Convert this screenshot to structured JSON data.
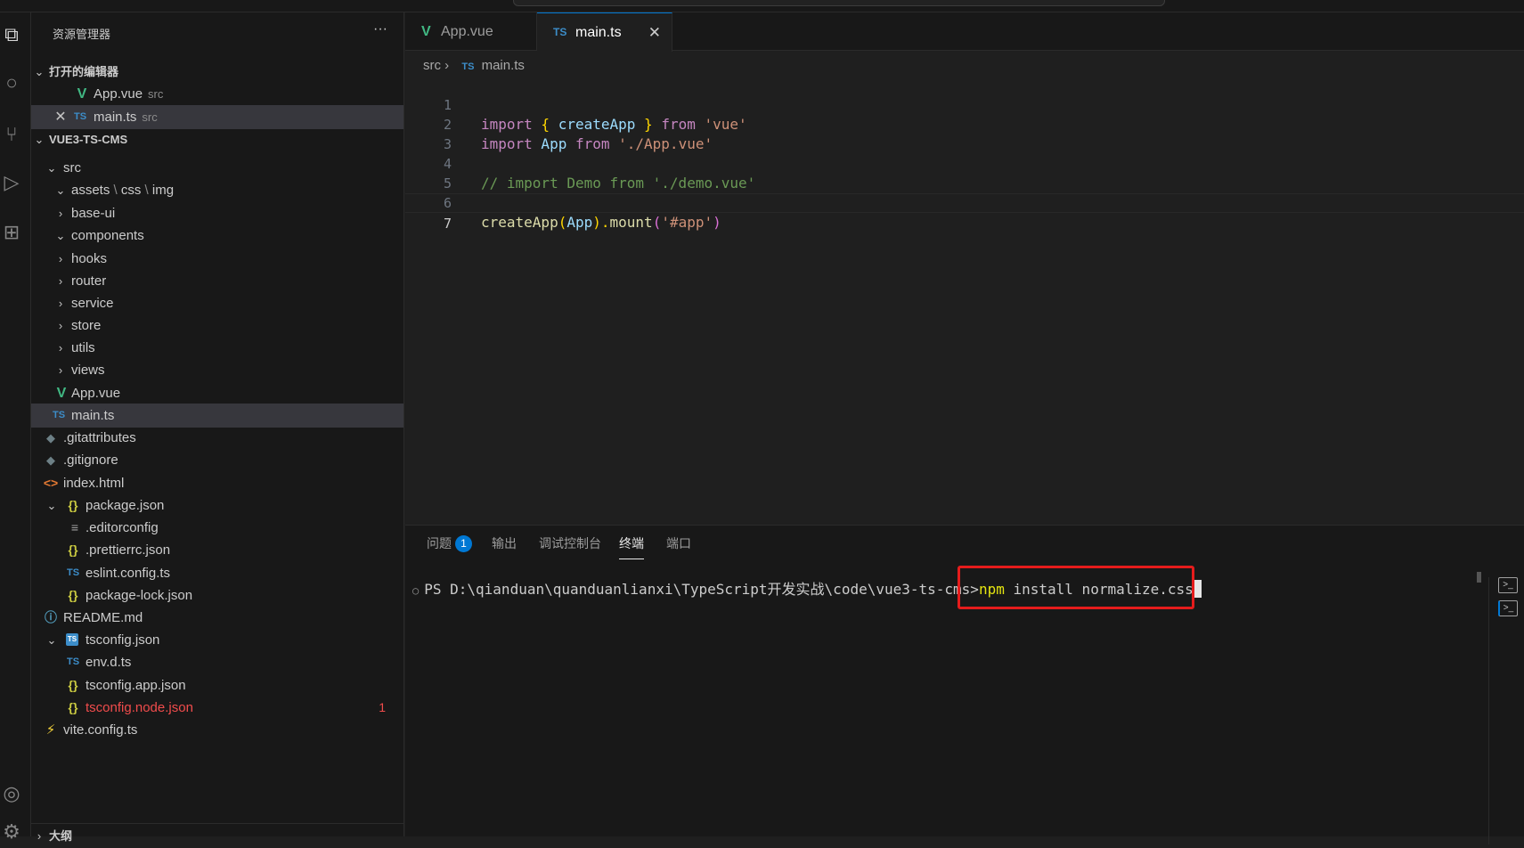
{
  "sidebar": {
    "title": "资源管理器",
    "more": "···",
    "open_editors_label": "打开的编辑器",
    "open_editors": [
      {
        "name": "App.vue",
        "path": "src",
        "icon": "vue-icon"
      },
      {
        "name": "main.ts",
        "path": "src",
        "icon": "ts-icon"
      }
    ],
    "project_label": "VUE3-TS-CMS",
    "outline_label": "大纲",
    "tree": [
      {
        "name": "src",
        "chevron": "⌄",
        "icon": ""
      },
      {
        "name": "assets",
        "extra": "css",
        "extra2": "img",
        "chevron": "⌄",
        "icon": ""
      },
      {
        "name": "base-ui",
        "chevron": "›",
        "icon": ""
      },
      {
        "name": "components",
        "chevron": "⌄",
        "icon": ""
      },
      {
        "name": "hooks",
        "chevron": "›",
        "icon": ""
      },
      {
        "name": "router",
        "chevron": "›",
        "icon": ""
      },
      {
        "name": "service",
        "chevron": "›",
        "icon": ""
      },
      {
        "name": "store",
        "chevron": "›",
        "icon": ""
      },
      {
        "name": "utils",
        "chevron": "›",
        "icon": ""
      },
      {
        "name": "views",
        "chevron": "›",
        "icon": ""
      },
      {
        "name": "App.vue",
        "icon": "V"
      },
      {
        "name": "main.ts",
        "icon": "TS"
      },
      {
        "name": ".gitattributes",
        "icon": "◆"
      },
      {
        "name": ".gitignore",
        "icon": "◆"
      },
      {
        "name": "index.html",
        "icon": "<>"
      },
      {
        "name": "package.json",
        "chevron": "⌄",
        "icon": "{}"
      },
      {
        "name": ".editorconfig",
        "icon": "≡"
      },
      {
        "name": ".prettierrc.json",
        "icon": "{}"
      },
      {
        "name": "eslint.config.ts",
        "icon": "TS"
      },
      {
        "name": "package-lock.json",
        "icon": "{}"
      },
      {
        "name": "README.md",
        "icon": "ⓘ"
      },
      {
        "name": "tsconfig.json",
        "chevron": "⌄",
        "icon": "TS"
      },
      {
        "name": "env.d.ts",
        "icon": "TS"
      },
      {
        "name": "tsconfig.app.json",
        "icon": "{}"
      },
      {
        "name": "tsconfig.node.json",
        "icon": "{}",
        "error_count": "1"
      },
      {
        "name": "vite.config.ts",
        "icon": "⚡"
      }
    ]
  },
  "tabs": [
    {
      "label": "App.vue",
      "icon": "V"
    },
    {
      "label": "main.ts",
      "icon": "TS",
      "close": "✕"
    }
  ],
  "breadcrumb": {
    "folder": "src",
    "sep": "›",
    "icon": "TS",
    "file": "main.ts"
  },
  "code": {
    "line_numbers": [
      "1",
      "2",
      "3",
      "4",
      "5",
      "6",
      "7"
    ],
    "l1": {
      "kw": "import",
      "b1": " { ",
      "name": "createApp",
      "b2": " } ",
      "from": "from",
      "str": " 'vue'"
    },
    "l2": {
      "kw": "import",
      "name": " App ",
      "from": "from",
      "str": " './App.vue'"
    },
    "l4": "// import Demo from './demo.vue'",
    "l6": {
      "fn": "createApp",
      "p1": "(",
      "arg": "App",
      "p2": ").",
      "method": "mount",
      "p3": "(",
      "str": "'#app'",
      "p4": ")"
    }
  },
  "panel": {
    "tabs": [
      "问题",
      "输出",
      "调试控制台",
      "终端",
      "端口"
    ],
    "problems_count": "1",
    "terminal_prompt": "PS D:\\qianduan\\quanduanlianxi\\TypeScript开发实战\\code\\vue3-ts-cms>",
    "terminal_cmd_npm": "npm",
    "terminal_cmd_rest": " install normalize.css"
  },
  "colors": {
    "keyword": "#c586c0",
    "keyword_blue": "#569cd6",
    "string": "#ce9178",
    "comment": "#6a9955",
    "variable": "#9cdcfe",
    "function": "#dcdcaa",
    "bracket": "#ffd700",
    "highlight_box": "#e51c1c"
  }
}
